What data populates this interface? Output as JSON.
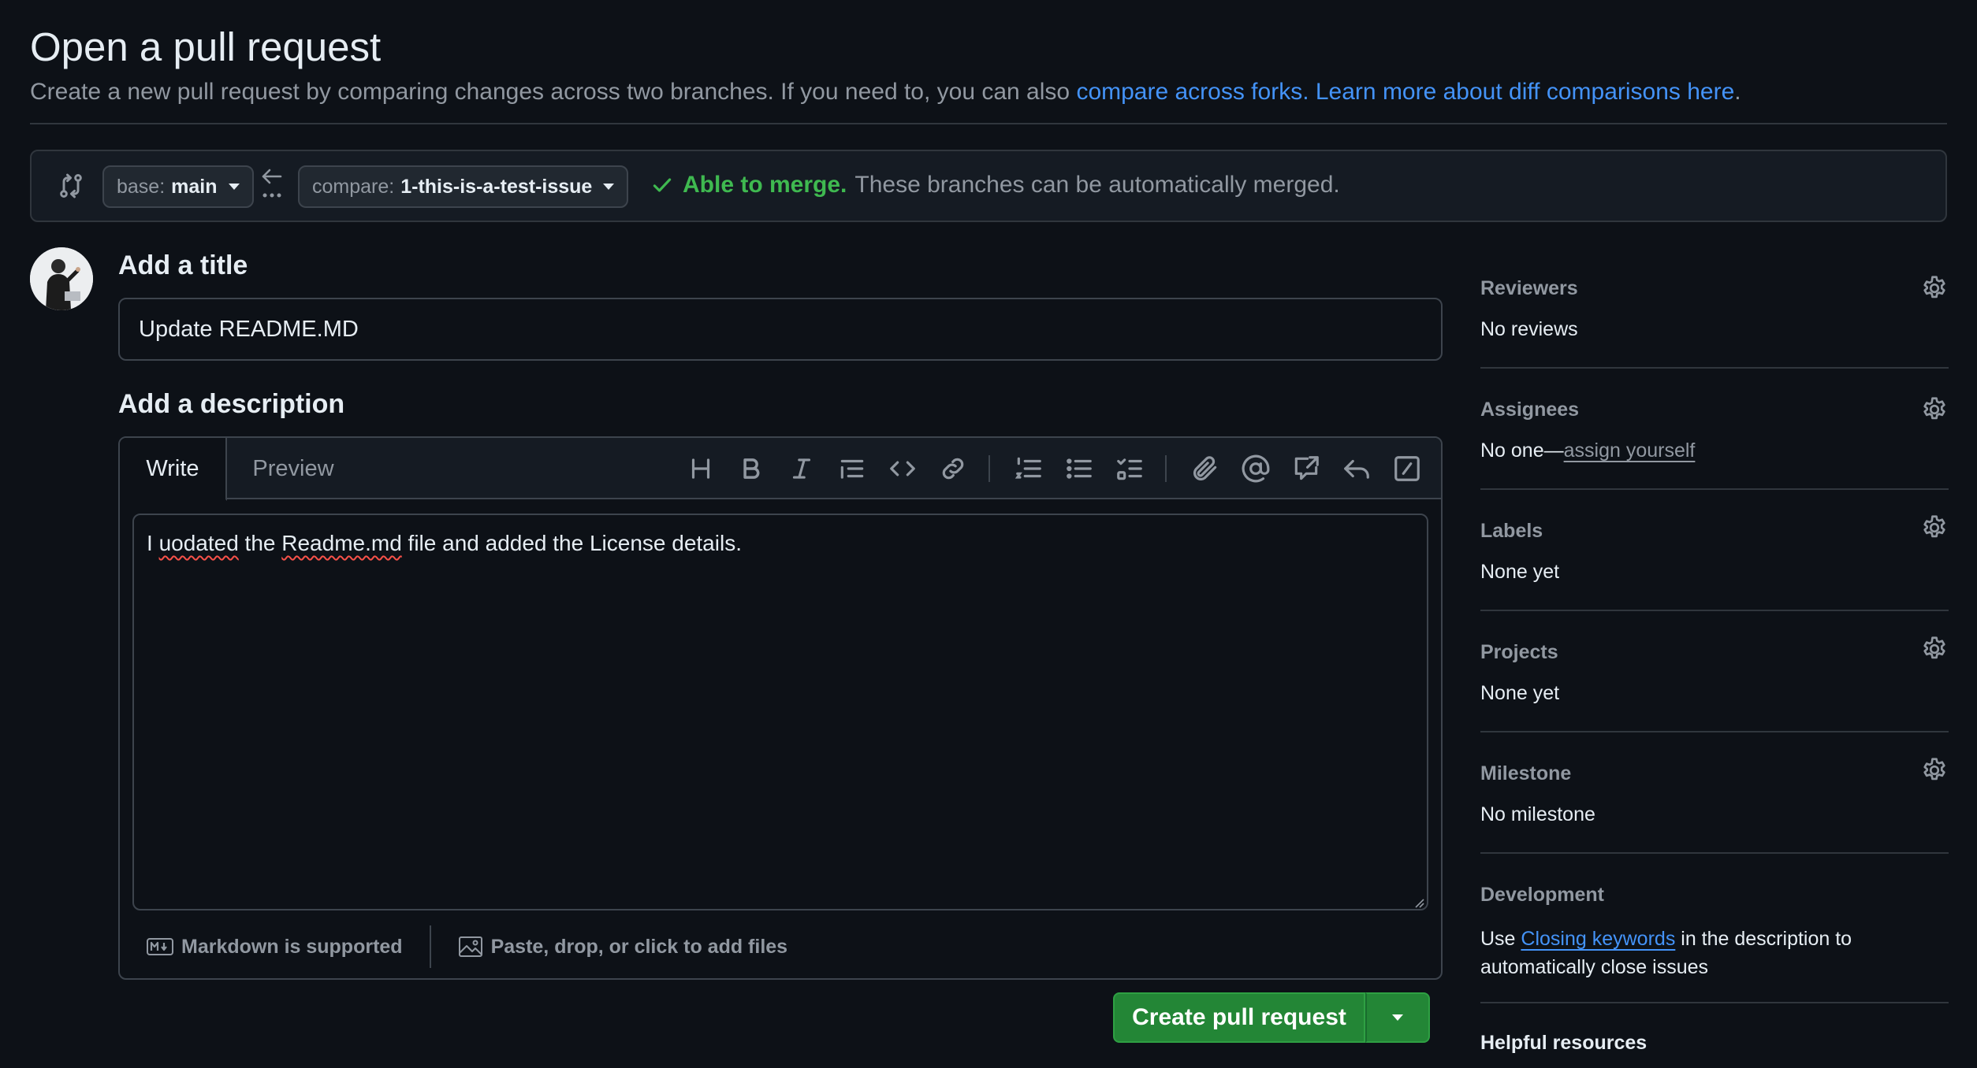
{
  "header": {
    "title": "Open a pull request",
    "subtitle_text": "Create a new pull request by comparing changes across two branches. If you need to, you can also ",
    "link_forks": "compare across forks.",
    "link_learn": "Learn more about diff comparisons here",
    "subtitle_end": "."
  },
  "compare_bar": {
    "base_prefix": "base:",
    "base_value": "main",
    "compare_prefix": "compare:",
    "compare_value": "1-this-is-a-test-issue",
    "merge_ok": "Able to merge.",
    "merge_text": "These branches can be automatically merged."
  },
  "form": {
    "title_heading": "Add a title",
    "title_value": "Update README.MD",
    "description_heading": "Add a description",
    "tab_write": "Write",
    "tab_preview": "Preview",
    "desc_parts": [
      "I ",
      "uodated",
      " the ",
      "Readme.md",
      " file and added the License details."
    ],
    "markdown_note": "Markdown is supported",
    "attach_note": "Paste, drop, or click to add files",
    "create_button": "Create pull request"
  },
  "sidebar": {
    "reviewers_label": "Reviewers",
    "reviewers_value": "No reviews",
    "assignees_label": "Assignees",
    "assignees_prefix": "No one—",
    "assignees_link": "assign yourself",
    "labels_label": "Labels",
    "labels_value": "None yet",
    "projects_label": "Projects",
    "projects_value": "None yet",
    "milestone_label": "Milestone",
    "milestone_value": "No milestone",
    "development_label": "Development",
    "development_prefix": "Use ",
    "development_link": "Closing keywords",
    "development_suffix": " in the description to automatically close issues",
    "helpful_label": "Helpful resources"
  },
  "colors": {
    "background": "#0d1117",
    "accent_link": "#4493f8",
    "success": "#3fb950",
    "button_green": "#238636"
  },
  "icons": [
    "git-compare-icon",
    "arrow-left-icon",
    "check-icon",
    "heading-icon",
    "bold-icon",
    "italic-icon",
    "quote-icon",
    "code-icon",
    "link-icon",
    "ordered-list-icon",
    "unordered-list-icon",
    "task-list-icon",
    "attach-icon",
    "mention-icon",
    "cross-reference-icon",
    "reply-icon",
    "slash-command-icon",
    "markdown-icon",
    "image-icon",
    "gear-icon"
  ]
}
